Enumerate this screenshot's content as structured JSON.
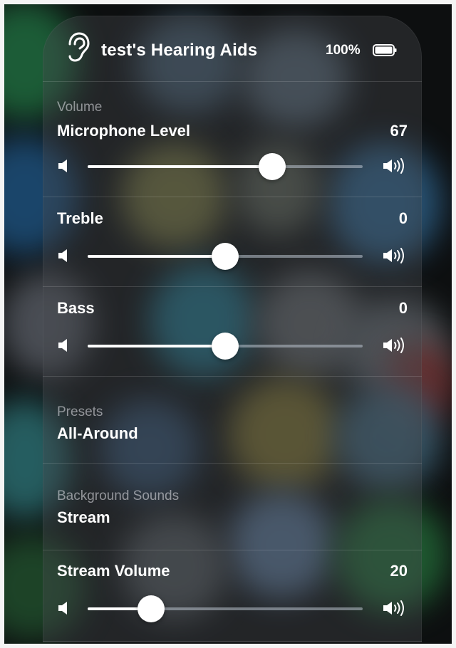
{
  "header": {
    "device_title": "test's Hearing Aids",
    "battery_percent": "100%",
    "battery_level": 1.0,
    "icon": "ear-icon"
  },
  "volume": {
    "caption": "Volume",
    "label": "Microphone Level",
    "value": "67",
    "level": 0.67
  },
  "treble": {
    "label": "Treble",
    "value": "0",
    "level": 0.5
  },
  "bass": {
    "label": "Bass",
    "value": "0",
    "level": 0.5
  },
  "presets": {
    "caption": "Presets",
    "value": "All-Around"
  },
  "background_sounds": {
    "caption": "Background Sounds",
    "value": "Stream"
  },
  "stream_volume": {
    "label": "Stream Volume",
    "value": "20",
    "level": 0.23
  },
  "icons": {
    "low": "speaker-low-icon",
    "high": "speaker-high-icon"
  }
}
